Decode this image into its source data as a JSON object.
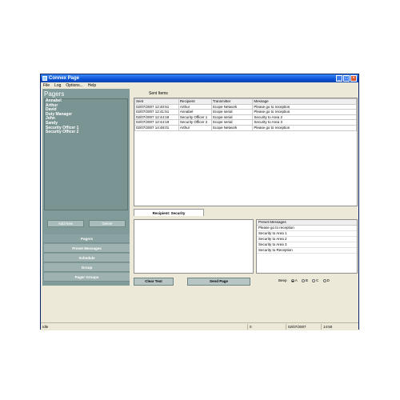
{
  "window": {
    "title": "Connex Page"
  },
  "menu": [
    "File",
    "Log",
    "Options...",
    "Help"
  ],
  "sidebar": {
    "title": "Pagers",
    "pagers": [
      "Annabel",
      "Arthur",
      "David",
      "Duty Manager",
      "John",
      "Sandy",
      "Security Officer 1",
      "Security Officer 2"
    ],
    "add_label": "Add New",
    "delete_label": "Delete",
    "nav": [
      "Pagers",
      "Preset Messages",
      "Schedule",
      "Group",
      "Pager Groups"
    ]
  },
  "sent_items": {
    "label": "Sent Items",
    "columns": [
      "Sent",
      "Recipient",
      "Transmitter",
      "Message"
    ],
    "rows": [
      [
        "02/07/2007 12:40:51",
        "Arthur",
        "Scope Network",
        "Please go to reception"
      ],
      [
        "02/07/2007 12:41:51",
        "Annabel",
        "Scope serial",
        "Please go to reception"
      ],
      [
        "02/07/2007 12:44:18",
        "Security Officer 1",
        "Scope serial",
        "Security to Area 2"
      ],
      [
        "02/07/2007 12:44:19",
        "Security Officer 2",
        "Scope serial",
        "Security to Area 3"
      ],
      [
        "02/07/2007 14:48:01",
        "Arthur",
        "Scope Network",
        "Please go to reception"
      ]
    ]
  },
  "compose": {
    "recipient_tab": "Recipient: Security",
    "message": "",
    "preset_header": "Preset Messages",
    "presets": [
      "Please go to reception",
      "Security to Area 1",
      "Security to Area 2",
      "Security to Area 3",
      "Security to Reception"
    ],
    "clear_label": "Clear Text",
    "send_label": "Send Page",
    "beep_label": "Beep",
    "beep_options": [
      "A",
      "B",
      "C",
      "D"
    ],
    "beep_selected": "A"
  },
  "status": {
    "text": "Idle",
    "count": "0",
    "date": "02/07/2007",
    "time": "14:50"
  }
}
